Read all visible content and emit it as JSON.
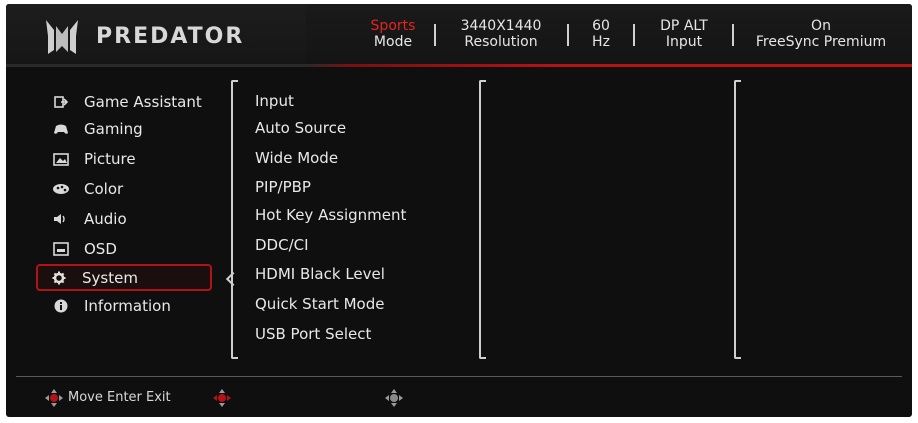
{
  "brand": {
    "logo_text": "PREDATOR"
  },
  "status_bar": [
    {
      "top": "Sports",
      "bottom": "Mode"
    },
    {
      "top": "3440X1440",
      "bottom": "Resolution"
    },
    {
      "top": "60",
      "bottom": "Hz"
    },
    {
      "top": "DP ALT",
      "bottom": "Input"
    },
    {
      "top": "On",
      "bottom": "FreeSync Premium"
    }
  ],
  "main_menu": [
    {
      "label": "Game Assistant",
      "icon": "game-assistant-icon"
    },
    {
      "label": "Gaming",
      "icon": "gaming-icon"
    },
    {
      "label": "Picture",
      "icon": "picture-icon"
    },
    {
      "label": "Color",
      "icon": "color-icon"
    },
    {
      "label": "Audio",
      "icon": "audio-icon"
    },
    {
      "label": "OSD",
      "icon": "osd-icon"
    },
    {
      "label": "System",
      "icon": "gear-icon",
      "selected": true
    },
    {
      "label": "Information",
      "icon": "information-icon"
    }
  ],
  "system_menu": [
    "Input",
    "Auto Source",
    "Wide Mode",
    "PIP/PBP",
    "Hot Key Assignment",
    "DDC/CI",
    "HDMI Black Level",
    "Quick Start Mode",
    "USB Port Select"
  ],
  "footer": {
    "hint": "Move Enter Exit"
  },
  "colors": {
    "accent": "#b31217",
    "accent_text": "#e52421",
    "background": "#0f0f0f",
    "text": "#e8e8e8"
  }
}
